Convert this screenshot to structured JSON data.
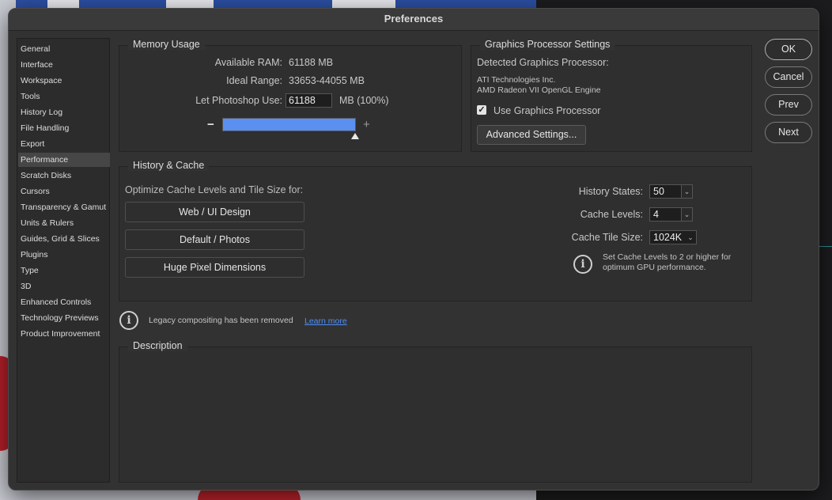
{
  "window": {
    "title": "Preferences"
  },
  "sidebar": {
    "items": [
      "General",
      "Interface",
      "Workspace",
      "Tools",
      "History Log",
      "File Handling",
      "Export",
      "Performance",
      "Scratch Disks",
      "Cursors",
      "Transparency & Gamut",
      "Units & Rulers",
      "Guides, Grid & Slices",
      "Plugins",
      "Type",
      "3D",
      "Enhanced Controls",
      "Technology Previews",
      "Product Improvement"
    ],
    "active": "Performance"
  },
  "memory": {
    "title": "Memory Usage",
    "available_label": "Available RAM:",
    "available_value": "61188 MB",
    "ideal_label": "Ideal Range:",
    "ideal_value": "33653-44055 MB",
    "use_label": "Let Photoshop Use:",
    "use_value": "61188",
    "use_unit": "MB (100%)",
    "slider_fraction": 1.0,
    "minus": "−",
    "plus": "+"
  },
  "gpu": {
    "title": "Graphics Processor Settings",
    "detected_label": "Detected Graphics Processor:",
    "vendor": "ATI Technologies Inc.",
    "model": "AMD Radeon VII OpenGL Engine",
    "use_gpu_label": "Use Graphics Processor",
    "use_gpu_checked": true,
    "advanced_button": "Advanced Settings..."
  },
  "cache": {
    "title": "History & Cache",
    "optimize_label": "Optimize Cache Levels and Tile Size for:",
    "presets": [
      "Web / UI Design",
      "Default / Photos",
      "Huge Pixel Dimensions"
    ],
    "history_states_label": "History States:",
    "history_states_value": "50",
    "cache_levels_label": "Cache Levels:",
    "cache_levels_value": "4",
    "tile_size_label": "Cache Tile Size:",
    "tile_size_value": "1024K",
    "tip_line1": "Set Cache Levels to 2 or higher for",
    "tip_line2": "optimum GPU performance."
  },
  "legacy": {
    "text": "Legacy compositing has been removed",
    "link": "Learn more"
  },
  "description": {
    "title": "Description"
  },
  "buttons": {
    "ok": "OK",
    "cancel": "Cancel",
    "prev": "Prev",
    "next": "Next"
  },
  "colors": {
    "slider_fill": "#5b8ff0",
    "link": "#4c8ef7",
    "checkbox": "#e4e4e4"
  }
}
